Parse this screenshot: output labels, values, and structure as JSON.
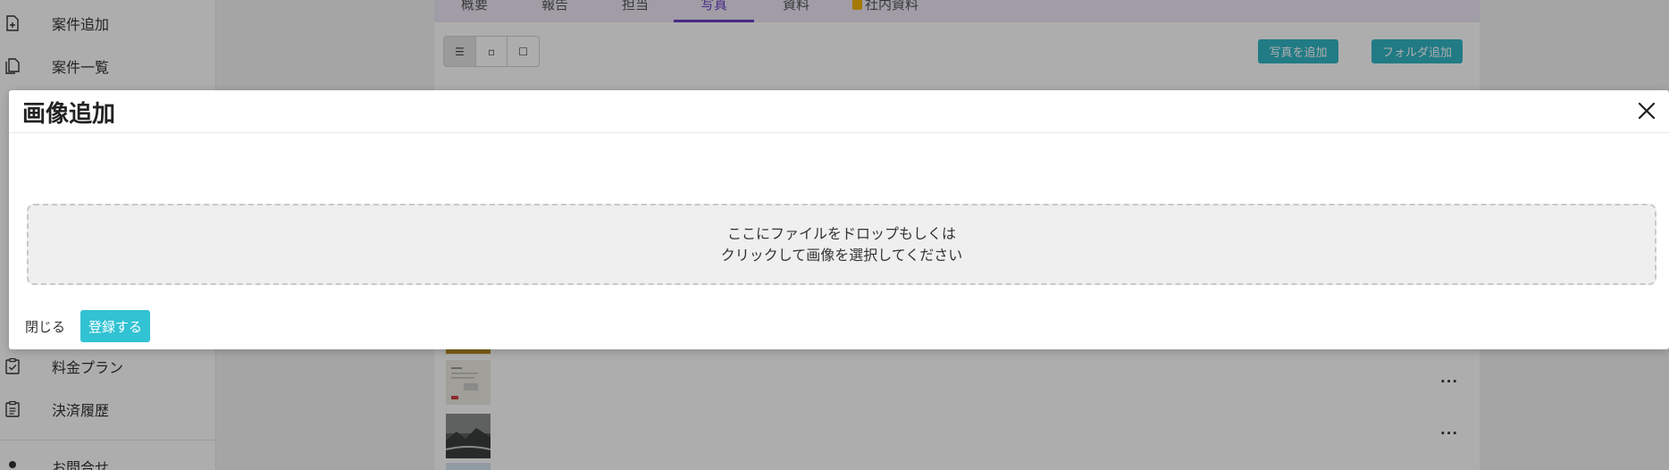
{
  "sidebar": {
    "items": [
      {
        "label": "案件追加",
        "icon": "document-add-icon"
      },
      {
        "label": "案件一覧",
        "icon": "documents-icon"
      },
      {
        "label": "料金プラン",
        "icon": "clipboard-check-icon"
      },
      {
        "label": "決済履歴",
        "icon": "clipboard-list-icon"
      },
      {
        "label": "お問合せ",
        "icon": "contact-icon"
      }
    ]
  },
  "tabs": [
    {
      "label": "概要"
    },
    {
      "label": "報告"
    },
    {
      "label": "担当"
    },
    {
      "label": "写真"
    },
    {
      "label": "資料"
    },
    {
      "label": "社内資料"
    }
  ],
  "toolbar": {
    "view_list": "☰",
    "view_small": "▫",
    "view_large": "☐",
    "add_photo_label": "写真を追加",
    "add_folder_label": "フォルダ追加"
  },
  "list": {
    "more_label": "···"
  },
  "modal": {
    "title": "画像追加",
    "dropzone_line1": "ここにファイルをドロップもしくは",
    "dropzone_line2": "クリックして画像を選択してください",
    "close_label": "閉じる",
    "submit_label": "登録する"
  },
  "colors": {
    "accent": "#31c2d3",
    "tab_active": "#6a3fc6"
  }
}
